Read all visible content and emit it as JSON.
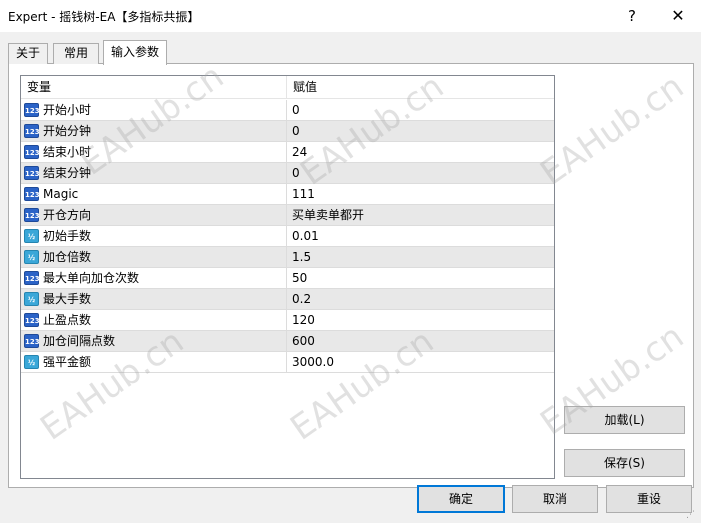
{
  "window": {
    "title": "Expert - 摇钱树-EA【多指标共振】",
    "help_glyph": "?",
    "close_glyph": "✕"
  },
  "tabs": [
    {
      "label": "关于",
      "active": false
    },
    {
      "label": "常用",
      "active": false
    },
    {
      "label": "输入参数",
      "active": true
    }
  ],
  "grid": {
    "header": {
      "variable": "变量",
      "value": "赋值"
    },
    "rows": [
      {
        "icon": "int-type-icon",
        "icon_text": "123",
        "name": "开始小时",
        "value": "0"
      },
      {
        "icon": "int-type-icon",
        "icon_text": "123",
        "name": "开始分钟",
        "value": "0"
      },
      {
        "icon": "int-type-icon",
        "icon_text": "123",
        "name": "结束小时",
        "value": "24"
      },
      {
        "icon": "int-type-icon",
        "icon_text": "123",
        "name": "结束分钟",
        "value": "0"
      },
      {
        "icon": "int-type-icon",
        "icon_text": "123",
        "name": "Magic",
        "value": "111"
      },
      {
        "icon": "int-type-icon",
        "icon_text": "123",
        "name": "开仓方向",
        "value": "买单卖单都开"
      },
      {
        "icon": "double-type-icon",
        "icon_text": "½",
        "name": "初始手数",
        "value": "0.01"
      },
      {
        "icon": "double-type-icon",
        "icon_text": "½",
        "name": "加仓倍数",
        "value": "1.5"
      },
      {
        "icon": "int-type-icon",
        "icon_text": "123",
        "name": "最大单向加仓次数",
        "value": "50"
      },
      {
        "icon": "double-type-icon",
        "icon_text": "½",
        "name": "最大手数",
        "value": "0.2"
      },
      {
        "icon": "int-type-icon",
        "icon_text": "123",
        "name": "止盈点数",
        "value": "120"
      },
      {
        "icon": "int-type-icon",
        "icon_text": "123",
        "name": "加仓间隔点数",
        "value": "600"
      },
      {
        "icon": "double-type-icon",
        "icon_text": "½",
        "name": "强平金额",
        "value": "3000.0"
      }
    ]
  },
  "buttons": {
    "load": "加载(L)",
    "save": "保存(S)",
    "ok": "确定",
    "cancel": "取消",
    "reset": "重设"
  },
  "watermark": "EAHub.cn"
}
